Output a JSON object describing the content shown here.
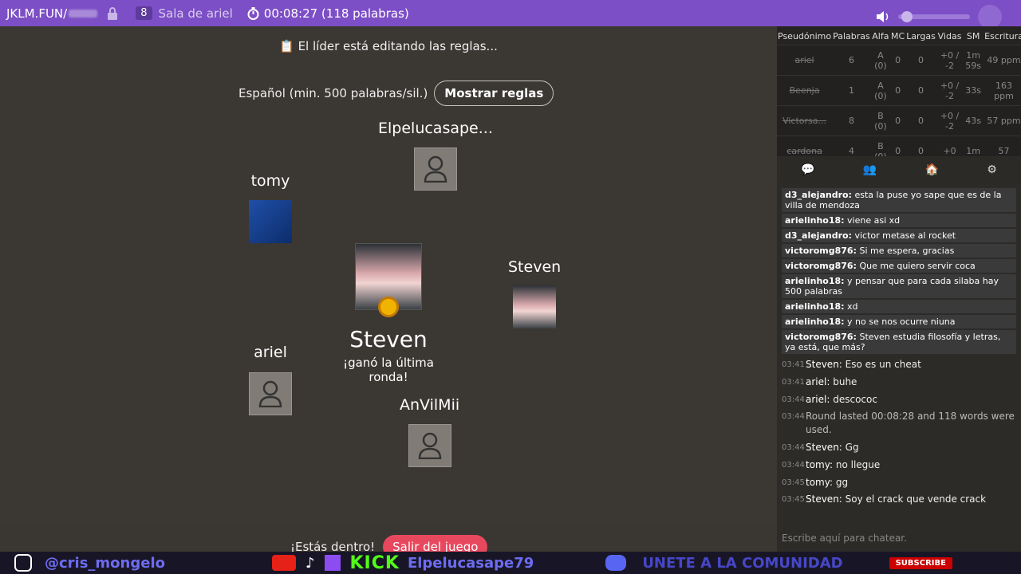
{
  "topbar": {
    "site": "JKLM.FUN/",
    "room_count": "8",
    "room_name": "Sala de ariel",
    "timer": "00:08:27 (118 palabras)"
  },
  "game": {
    "status": "📋 El líder está editando las reglas...",
    "rules_text": "Español (min. 500 palabras/sil.)",
    "rules_button": "Mostrar reglas",
    "players": {
      "top": "Elpelucasape...",
      "left_top": "tomy",
      "right": "Steven",
      "left_bottom": "ariel",
      "bottom": "AnVilMii"
    },
    "winner_name": "Steven",
    "winner_sub": "¡ganó la última ronda!",
    "inside_text": "¡Estás dentro!",
    "leave_button": "Salir del juego"
  },
  "scores": {
    "headers": [
      "Pseudónimo",
      "Palabras",
      "Alfa",
      "MC",
      "Largas",
      "Vidas",
      "SM",
      "Escritura"
    ],
    "rows": [
      [
        "ariel",
        "6",
        "A (0)",
        "0",
        "0",
        "+0 / -2",
        "1m 59s",
        "49 ppm"
      ],
      [
        "Beenja",
        "1",
        "A (0)",
        "0",
        "0",
        "+0 / -2",
        "33s",
        "163 ppm"
      ],
      [
        "Victorsa...",
        "8",
        "B (0)",
        "0",
        "0",
        "+0 / -2",
        "43s",
        "57 ppm"
      ],
      [
        "cardona",
        "4",
        "B (0)",
        "0",
        "0",
        "+0",
        "1m",
        "57"
      ]
    ]
  },
  "chat_tabs": [
    "💬",
    "👥",
    "🏠",
    "⚙"
  ],
  "chat": {
    "overlay_messages": [
      {
        "user": "d3_alejandro:",
        "text": "esta la puse yo sape que es de la villa de mendoza"
      },
      {
        "user": "arielinho18:",
        "text": "viene asi xd"
      },
      {
        "user": "d3_alejandro:",
        "text": "victor metase al rocket"
      },
      {
        "user": "victoromg876:",
        "text": "Si me espera, gracias"
      },
      {
        "user": "victoromg876:",
        "text": "Que me quiero servir coca"
      },
      {
        "user": "arielinho18:",
        "text": "y pensar que para cada silaba hay 500 palabras"
      },
      {
        "user": "arielinho18:",
        "text": "xd"
      },
      {
        "user": "arielinho18:",
        "text": "y no se nos ocurre niuna"
      },
      {
        "user": "victoromg876:",
        "text": "Steven estudia filosofía y letras, ya está, que más?"
      }
    ],
    "messages": [
      {
        "time": "03:41",
        "who": "Steven:",
        "text": "Eso es un cheat"
      },
      {
        "time": "03:41",
        "who": "ariel:",
        "text": "buhe"
      },
      {
        "time": "03:44",
        "who": "ariel:",
        "text": "descococ"
      },
      {
        "time": "03:44",
        "who": "",
        "text": "Round lasted 00:08:28 and 118 words were used."
      },
      {
        "time": "03:44",
        "who": "Steven:",
        "text": "Gg"
      },
      {
        "time": "03:44",
        "who": "tomy:",
        "text": "no llegue"
      },
      {
        "time": "03:45",
        "who": "tomy:",
        "text": "gg"
      },
      {
        "time": "03:45",
        "who": "Steven:",
        "text": "Soy el crack que vende crack"
      }
    ],
    "input_placeholder": "Escribe aquí para chatear."
  },
  "footer": {
    "handle": "@cris_mongelo",
    "kick": "KICK",
    "kick_name": "Elpelucasape79",
    "unite": "UNETE A LA COMUNIDAD",
    "subscribe": "SUBSCRIBE"
  }
}
